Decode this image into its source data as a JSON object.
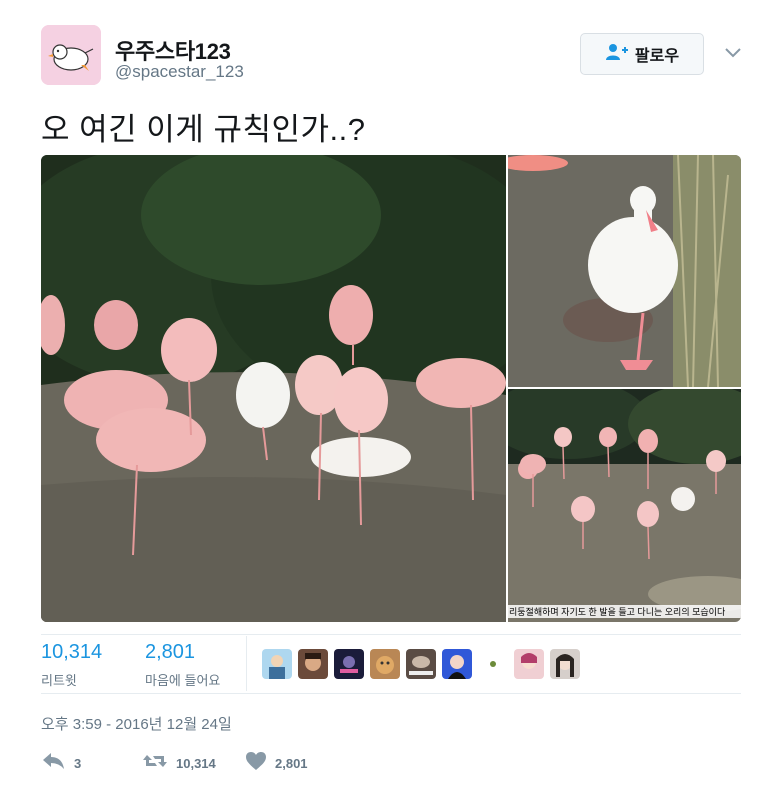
{
  "user": {
    "display_name": "우주스타123",
    "handle": "@spacestar_123",
    "avatar_icon": "bird-cartoon-avatar"
  },
  "follow": {
    "label": "팔로우",
    "icon": "add-user-icon"
  },
  "tweet": {
    "text": "오 여긴 이게 규칙인가..?"
  },
  "media": {
    "caption": "리둥절해하며 자기도 한 발을 들고 다니는 오리의 모습이다"
  },
  "stats": {
    "retweets": {
      "count": "10,314",
      "label": "리트윗"
    },
    "likes": {
      "count": "2,801",
      "label": "마음에 들어요"
    }
  },
  "timestamp": "오후 3:59 - 2016년 12월 24일",
  "actions": {
    "reply_count": "3",
    "retweet_count": "10,314",
    "like_count": "2,801"
  },
  "colors": {
    "link_blue": "#1b95e0",
    "muted_gray": "#657786"
  }
}
